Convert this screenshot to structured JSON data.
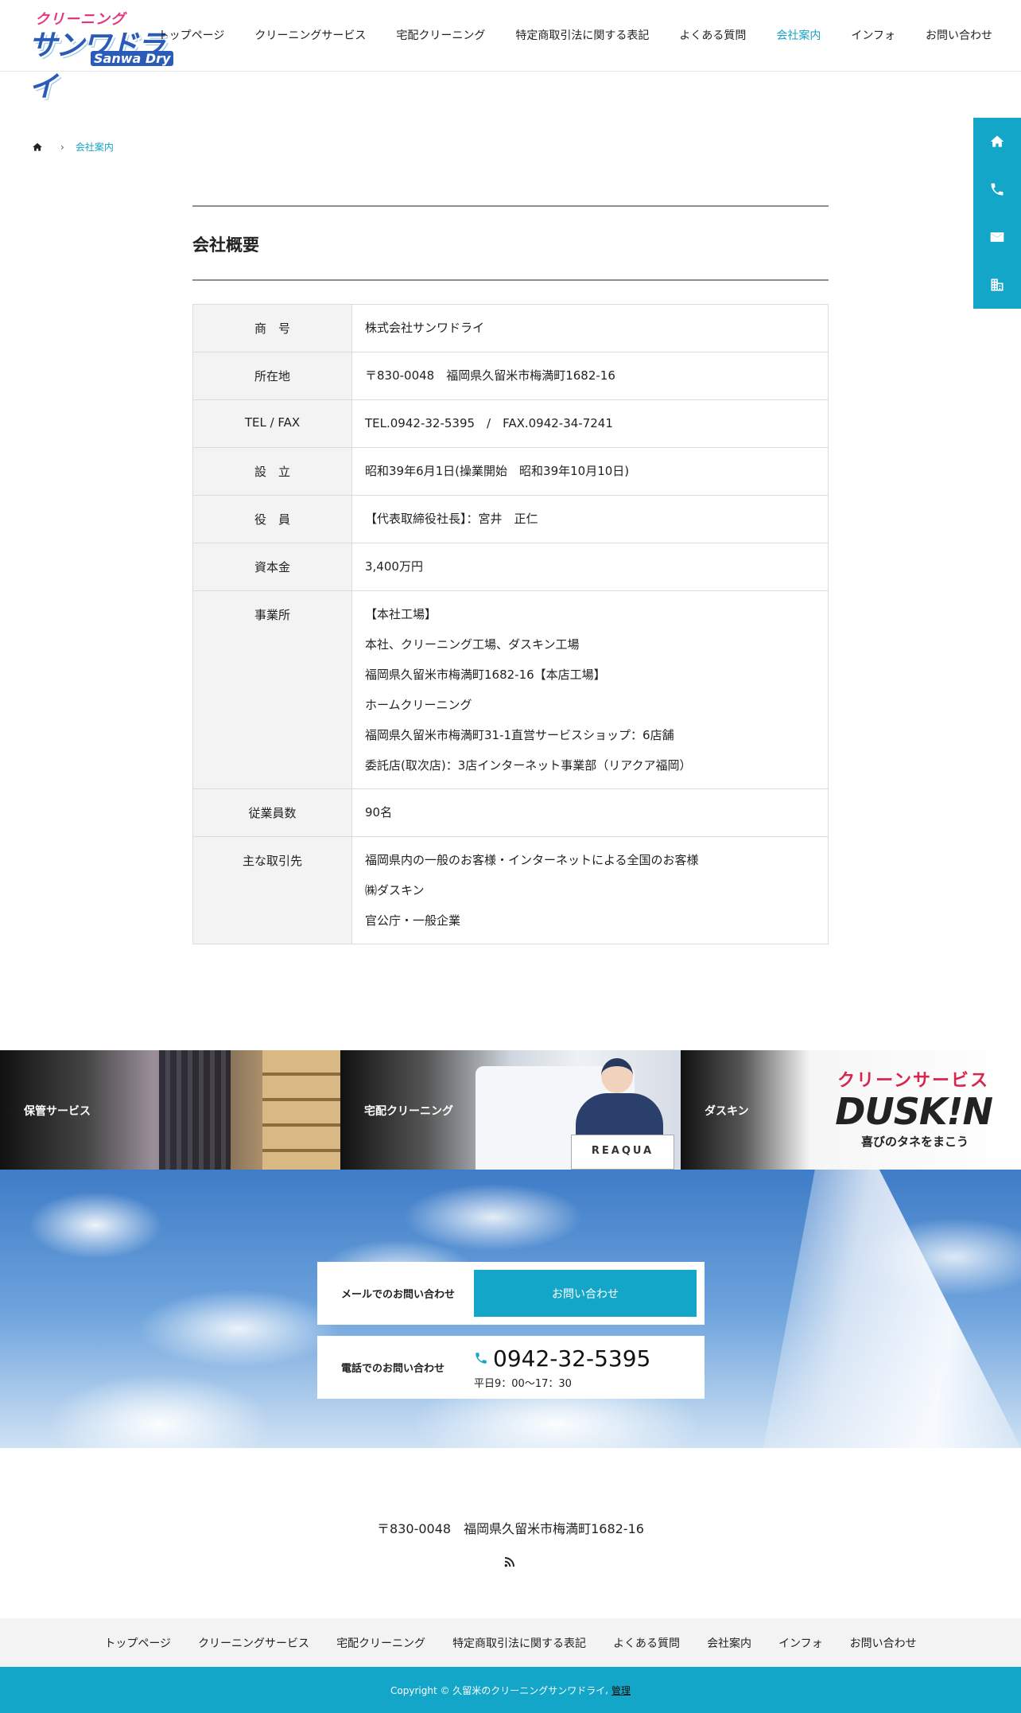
{
  "logo": {
    "top": "クリーニング",
    "main": "サンワドライ",
    "sub": "Sanwa Dry"
  },
  "nav": [
    {
      "label": "トップページ"
    },
    {
      "label": "クリーニングサービス"
    },
    {
      "label": "宅配クリーニング"
    },
    {
      "label": "特定商取引法に関する表記"
    },
    {
      "label": "よくある質問"
    },
    {
      "label": "会社案内",
      "active": true
    },
    {
      "label": "インフォ"
    },
    {
      "label": "お問い合わせ"
    }
  ],
  "side_buttons": [
    "home-icon",
    "phone-icon",
    "mail-icon",
    "building-icon"
  ],
  "breadcrumb": {
    "current": "会社案内"
  },
  "page_title": "会社概要",
  "company": [
    {
      "label": "商　号",
      "lines": [
        "株式会社サンワドライ"
      ]
    },
    {
      "label": "所在地",
      "lines": [
        "〒830-0048　福岡県久留米市梅満町1682-16"
      ]
    },
    {
      "label": "TEL / FAX",
      "lines": [
        "TEL.0942-32-5395　/　FAX.0942-34-7241"
      ]
    },
    {
      "label": "設　立",
      "lines": [
        "昭和39年6月1日(操業開始　昭和39年10月10日)"
      ]
    },
    {
      "label": "役　員",
      "lines": [
        "【代表取締役社長】：宮井　正仁"
      ]
    },
    {
      "label": "資本金",
      "lines": [
        "3,400万円"
      ]
    },
    {
      "label": "事業所",
      "lines": [
        "【本社工場】",
        "本社、クリーニング工場、ダスキン工場",
        "福岡県久留米市梅満町1682-16【本店工場】",
        "ホームクリーニング",
        "福岡県久留米市梅満町31-1直営サービスショップ：6店舗",
        "委託店(取次店)：3店インターネット事業部（リアクア福岡）"
      ]
    },
    {
      "label": "従業員数",
      "lines": [
        "90名"
      ]
    },
    {
      "label": "主な取引先",
      "lines": [
        "福岡県内の一般のお客様・インターネットによる全国のお客様",
        "㈱ダスキン",
        "官公庁・一般企業"
      ]
    }
  ],
  "banners": [
    {
      "label": "保管サービス"
    },
    {
      "label": "宅配クリーニング",
      "box_text": "REAQUA"
    },
    {
      "label": "ダスキン",
      "top": "クリーンサービス",
      "main": "DUSK!N",
      "sub": "喜びのタネをまこう"
    }
  ],
  "contact": {
    "mail_label": "メールでのお問い合わせ",
    "mail_button": "お問い合わせ",
    "tel_label": "電話でのお問い合わせ",
    "tel_number": "0942-32-5395",
    "tel_hours": "平日9：00〜17：30"
  },
  "footer": {
    "address": "〒830-0048　福岡県久留米市梅満町1682-16",
    "nav": [
      "トップページ",
      "クリーニングサービス",
      "宅配クリーニング",
      "特定商取引法に関する表記",
      "よくある質問",
      "会社案内",
      "インフォ",
      "お問い合わせ"
    ],
    "copyright": "Copyright © 久留米のクリーニングサンワドライ",
    "admin_link": "管理"
  },
  "colors": {
    "accent": "#14a6c8",
    "active_nav": "#17a2c0",
    "table_header_bg": "#f3f3f3"
  }
}
